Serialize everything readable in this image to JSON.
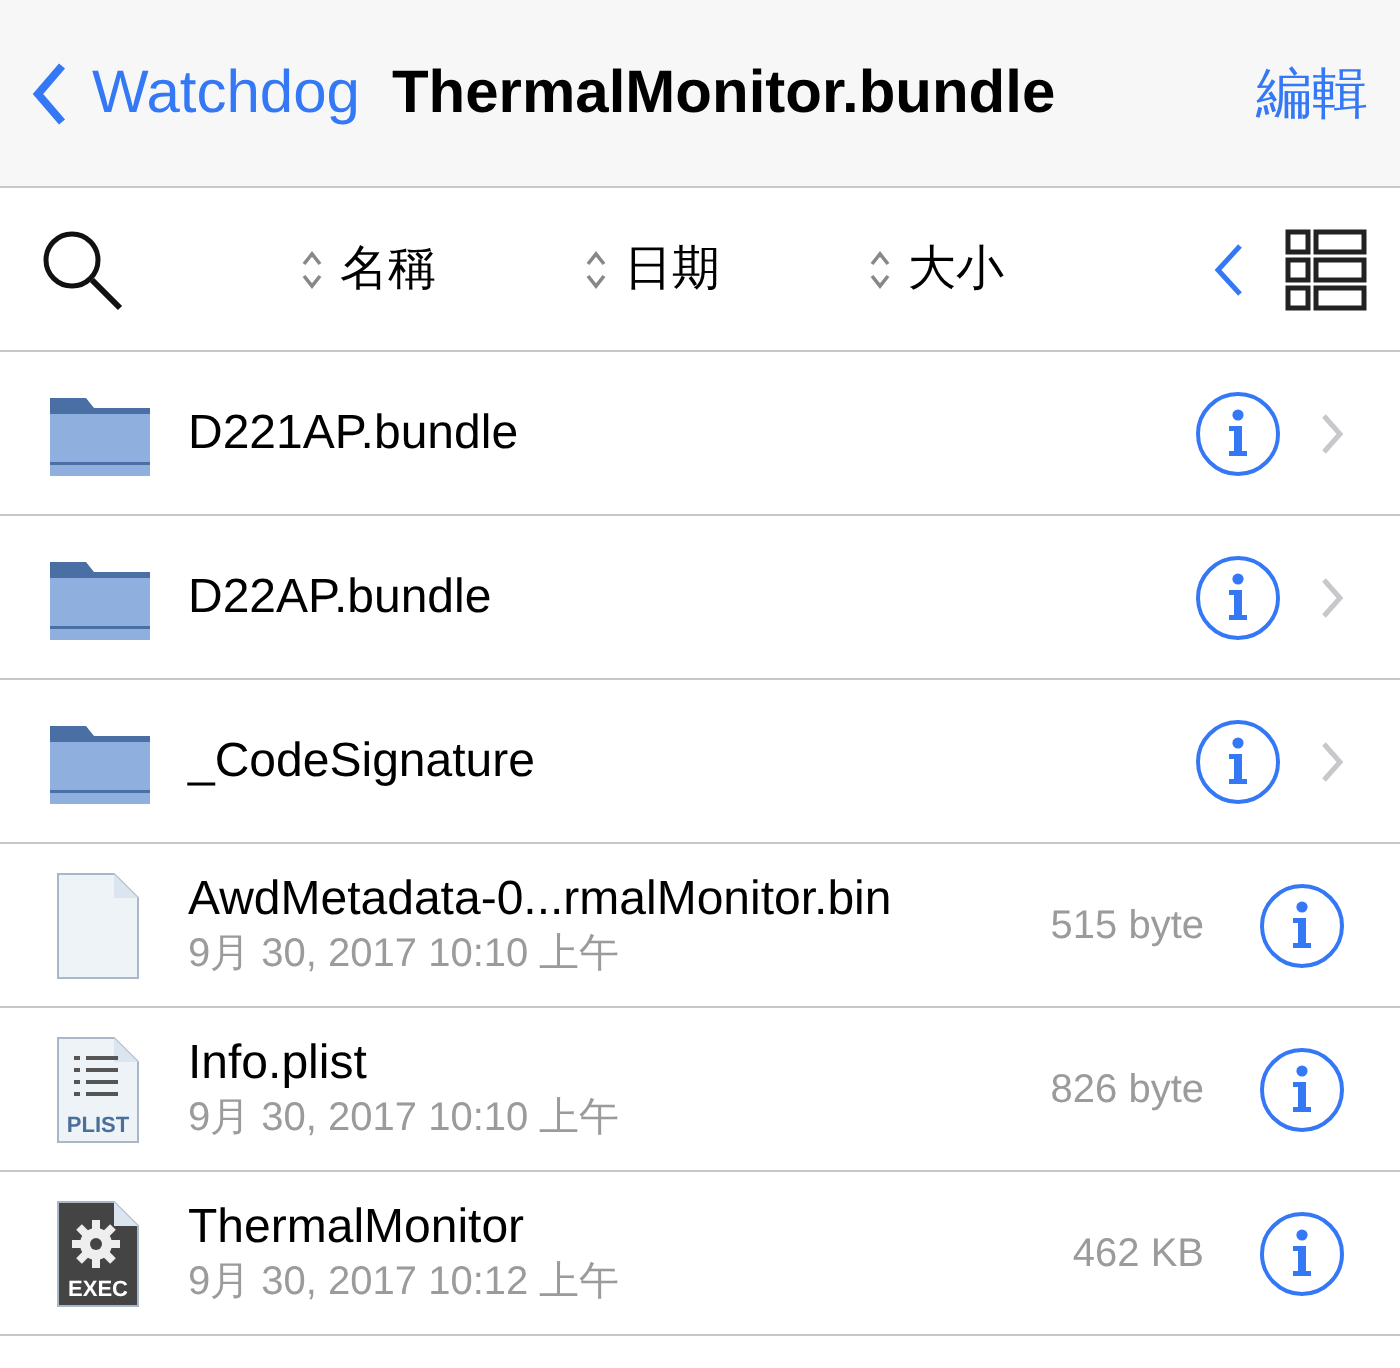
{
  "nav": {
    "back": "Watchdog",
    "title": "ThermalMonitor.bundle",
    "action": "編輯"
  },
  "sort_bar": {
    "options": [
      {
        "label": "名稱"
      },
      {
        "label": "日期"
      },
      {
        "label": "大小"
      }
    ]
  },
  "rows": [
    {
      "kind": "folder",
      "name": "D221AP.bundle"
    },
    {
      "kind": "folder",
      "name": "D22AP.bundle"
    },
    {
      "kind": "folder",
      "name": "_CodeSignature"
    },
    {
      "kind": "file",
      "name": "AwdMetadata-0...rmalMonitor.bin",
      "date": "9月 30, 2017 10:10 上午",
      "size": "515 byte",
      "icon": {
        "kind": "blank"
      }
    },
    {
      "kind": "file",
      "name": "Info.plist",
      "date": "9月 30, 2017 10:10 上午",
      "size": "826 byte",
      "icon": {
        "kind": "list",
        "label": "PLIST"
      }
    },
    {
      "kind": "file",
      "name": "ThermalMonitor",
      "date": "9月 30, 2017 10:12 上午",
      "size": "462 KB",
      "icon": {
        "kind": "gear",
        "label": "EXEC"
      }
    }
  ]
}
